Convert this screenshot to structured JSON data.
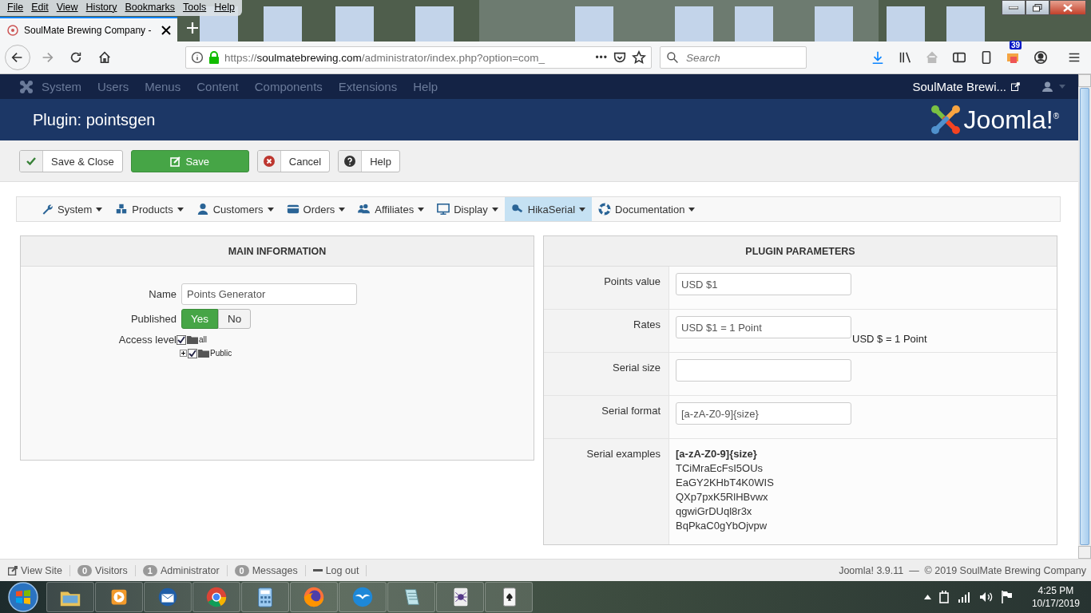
{
  "browser": {
    "menu": [
      "File",
      "Edit",
      "View",
      "History",
      "Bookmarks",
      "Tools",
      "Help"
    ],
    "tab": {
      "title": "SoulMate Brewing Company - ",
      "selected": true
    },
    "url": {
      "scheme": "https://",
      "host": "soulmatebrewing.com",
      "path": "/administrator/index.php?option=com_"
    },
    "more": "•••",
    "search": {
      "placeholder": "Search"
    },
    "addon_badge": "39"
  },
  "admin_nav": {
    "items": [
      "System",
      "Users",
      "Menus",
      "Content",
      "Components",
      "Extensions",
      "Help"
    ],
    "site": "SoulMate Brewi..."
  },
  "title": "Plugin: pointsgen",
  "logo": "Joomla!$^{®}$",
  "toolbar": [
    {
      "kind": "check",
      "label": "Save & Close"
    },
    {
      "kind": "primary",
      "label": "Save"
    },
    {
      "kind": "cancel",
      "label": "Cancel"
    },
    {
      "kind": "help",
      "label": "Help"
    }
  ],
  "submenu": [
    {
      "kind": "wrench",
      "label": "System",
      "selected": false
    },
    {
      "kind": "cubes",
      "label": "Products",
      "selected": false
    },
    {
      "kind": "user",
      "label": "Customers",
      "selected": false
    },
    {
      "kind": "card",
      "label": "Orders",
      "selected": false
    },
    {
      "kind": "users",
      "label": "Affiliates",
      "selected": false
    },
    {
      "kind": "monitor",
      "label": "Display",
      "selected": false
    },
    {
      "kind": "key",
      "label": "HikaSerial",
      "selected": true
    },
    {
      "kind": "lifebuoy",
      "label": "Documentation",
      "selected": false
    }
  ],
  "main": {
    "title": "MAIN INFORMATION",
    "name": {
      "label": "Name",
      "value": "Points Generator"
    },
    "published": {
      "label": "Published",
      "options": [
        {
          "label": "Yes",
          "selected": true
        },
        {
          "label": "No",
          "selected": false
        }
      ]
    },
    "access": {
      "label": "Access level",
      "tree": [
        {
          "label": "all",
          "checked": true,
          "children": [
            {
              "label": "Public",
              "checked": true,
              "expanded": false
            }
          ]
        }
      ]
    }
  },
  "params": {
    "title": "PLUGIN PARAMETERS",
    "rows": [
      {
        "kind": "field",
        "label": "Points value",
        "value": "USD $1"
      },
      {
        "kind": "field",
        "label": "Rates",
        "value": "USD $1 = 1 Point",
        "note": "USD $ = 1 Point"
      },
      {
        "kind": "field",
        "label": "Serial size"
      },
      {
        "kind": "field",
        "label": "Serial format",
        "value": "[a-zA-Z0-9]{size}"
      },
      {
        "kind": "list",
        "label": "Serial examples",
        "heading": "[a-zA-Z0-9]{size}",
        "items": [
          "TCiMraEcFsI5OUs",
          "EaGY2KHbT4K0WIS",
          "QXp7pxK5RlHBvwx",
          "qgwiGrDUql8r3x",
          "BqPkaC0gYbOjvpw"
        ]
      }
    ]
  },
  "status": {
    "items": [
      {
        "kind": "link",
        "label": "View Site"
      },
      {
        "kind": "count",
        "count": "0",
        "label": "Visitors"
      },
      {
        "kind": "count",
        "count": "1",
        "label": "Administrator"
      },
      {
        "kind": "count",
        "count": "0",
        "label": "Messages"
      },
      {
        "kind": "logout",
        "label": "Log out"
      }
    ],
    "copyright": "Joomla! 3.9.11  —  © 2019 SoulMate Brewing Company"
  },
  "taskbar": {
    "time": "4:25 PM",
    "date": "10/17/2019"
  }
}
